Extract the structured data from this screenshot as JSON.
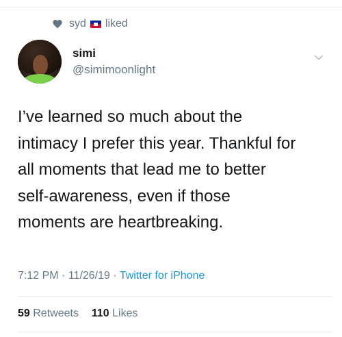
{
  "social_context": {
    "name": "syd",
    "action": "liked",
    "flag_colors": {
      "top": "#00209f",
      "bottom": "#d21034"
    }
  },
  "author": {
    "display_name": "simi",
    "handle": "@simimoonlight"
  },
  "tweet": {
    "lines": [
      "I’ve learned so much about the",
      "intimacy I prefer this year. Thankful for",
      "all moments that lead me to better",
      "self-awareness, even if those",
      "moments are heartbreaking."
    ]
  },
  "meta": {
    "time": "7:12 PM",
    "date": "11/26/19",
    "separator": "·",
    "source": "Twitter for iPhone"
  },
  "stats": {
    "retweets_count": "59",
    "retweets_label": "Retweets",
    "likes_count": "110",
    "likes_label": "Likes"
  },
  "colors": {
    "text": "#14171a",
    "secondary": "#657786",
    "link": "#1b95e0",
    "divider": "#e6ecf0"
  },
  "icons": {
    "social_context": "heart-icon",
    "flag": "haiti-flag-icon",
    "menu": "chevron-down-icon"
  }
}
